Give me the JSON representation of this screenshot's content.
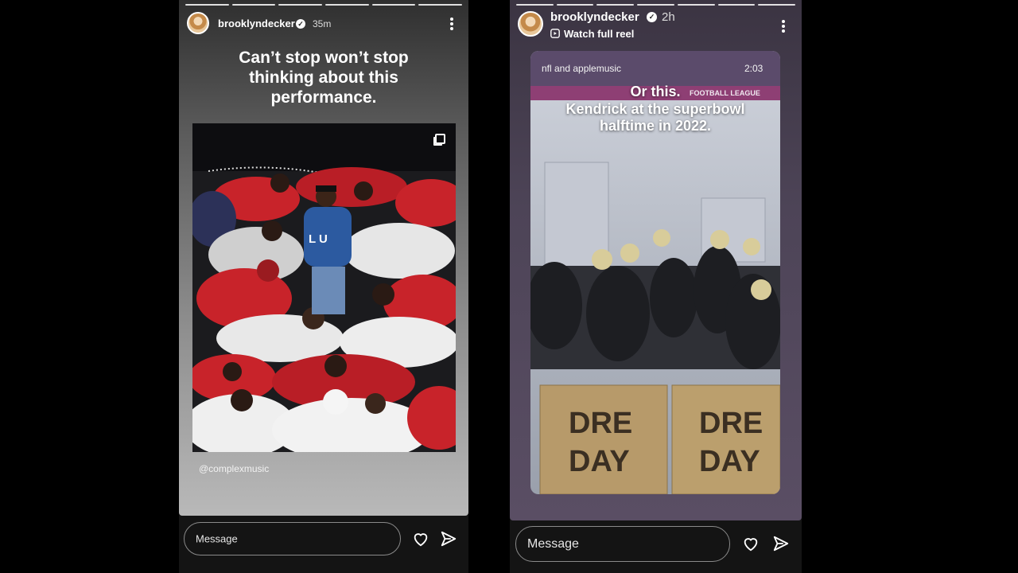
{
  "left_story": {
    "username": "brooklyndecker",
    "time": "35m",
    "caption_lines": [
      "Can’t stop won’t stop",
      "thinking about this",
      "performance."
    ],
    "photo_credit": "@complexmusic",
    "message_placeholder": "Message",
    "icons": [
      "verified-badge-icon",
      "more-options-icon",
      "carousel-icon",
      "heart-icon",
      "send-icon"
    ]
  },
  "right_story": {
    "username": "brooklyndecker",
    "time": "2h",
    "subtitle": "Watch full reel",
    "reel_account": "nfl and applemusic",
    "reel_duration": "2:03",
    "caption_lines": [
      "Or this.",
      "Kendrick at the superbowl",
      "halftime in 2022."
    ],
    "box_text": "DRE DAY",
    "stadium_sign": "FOOTBALL LEAGUE",
    "message_placeholder": "Message",
    "icons": [
      "verified-badge-icon",
      "reel-icon",
      "more-options-icon",
      "heart-icon",
      "send-icon"
    ]
  },
  "colors": {
    "background": "#000000",
    "left_story_bg": "#8a8a8a",
    "right_story_bg": "#4d4457",
    "white": "#ffffff"
  }
}
